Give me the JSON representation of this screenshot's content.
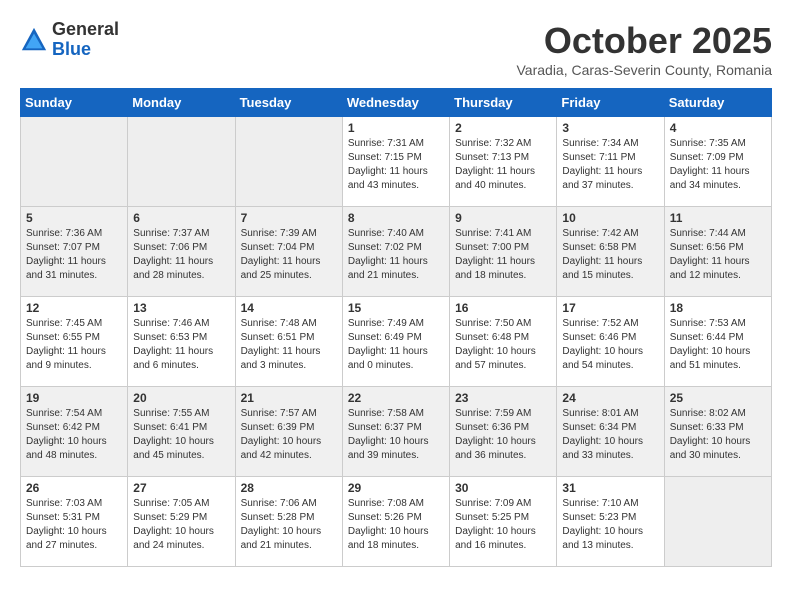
{
  "logo": {
    "general": "General",
    "blue": "Blue"
  },
  "header": {
    "month": "October 2025",
    "subtitle": "Varadia, Caras-Severin County, Romania"
  },
  "weekdays": [
    "Sunday",
    "Monday",
    "Tuesday",
    "Wednesday",
    "Thursday",
    "Friday",
    "Saturday"
  ],
  "weeks": [
    [
      {
        "day": "",
        "empty": true
      },
      {
        "day": "",
        "empty": true
      },
      {
        "day": "",
        "empty": true
      },
      {
        "day": "1",
        "sunrise": "7:31 AM",
        "sunset": "7:15 PM",
        "daylight": "11 hours and 43 minutes."
      },
      {
        "day": "2",
        "sunrise": "7:32 AM",
        "sunset": "7:13 PM",
        "daylight": "11 hours and 40 minutes."
      },
      {
        "day": "3",
        "sunrise": "7:34 AM",
        "sunset": "7:11 PM",
        "daylight": "11 hours and 37 minutes."
      },
      {
        "day": "4",
        "sunrise": "7:35 AM",
        "sunset": "7:09 PM",
        "daylight": "11 hours and 34 minutes."
      }
    ],
    [
      {
        "day": "5",
        "sunrise": "7:36 AM",
        "sunset": "7:07 PM",
        "daylight": "11 hours and 31 minutes."
      },
      {
        "day": "6",
        "sunrise": "7:37 AM",
        "sunset": "7:06 PM",
        "daylight": "11 hours and 28 minutes."
      },
      {
        "day": "7",
        "sunrise": "7:39 AM",
        "sunset": "7:04 PM",
        "daylight": "11 hours and 25 minutes."
      },
      {
        "day": "8",
        "sunrise": "7:40 AM",
        "sunset": "7:02 PM",
        "daylight": "11 hours and 21 minutes."
      },
      {
        "day": "9",
        "sunrise": "7:41 AM",
        "sunset": "7:00 PM",
        "daylight": "11 hours and 18 minutes."
      },
      {
        "day": "10",
        "sunrise": "7:42 AM",
        "sunset": "6:58 PM",
        "daylight": "11 hours and 15 minutes."
      },
      {
        "day": "11",
        "sunrise": "7:44 AM",
        "sunset": "6:56 PM",
        "daylight": "11 hours and 12 minutes."
      }
    ],
    [
      {
        "day": "12",
        "sunrise": "7:45 AM",
        "sunset": "6:55 PM",
        "daylight": "11 hours and 9 minutes."
      },
      {
        "day": "13",
        "sunrise": "7:46 AM",
        "sunset": "6:53 PM",
        "daylight": "11 hours and 6 minutes."
      },
      {
        "day": "14",
        "sunrise": "7:48 AM",
        "sunset": "6:51 PM",
        "daylight": "11 hours and 3 minutes."
      },
      {
        "day": "15",
        "sunrise": "7:49 AM",
        "sunset": "6:49 PM",
        "daylight": "11 hours and 0 minutes."
      },
      {
        "day": "16",
        "sunrise": "7:50 AM",
        "sunset": "6:48 PM",
        "daylight": "10 hours and 57 minutes."
      },
      {
        "day": "17",
        "sunrise": "7:52 AM",
        "sunset": "6:46 PM",
        "daylight": "10 hours and 54 minutes."
      },
      {
        "day": "18",
        "sunrise": "7:53 AM",
        "sunset": "6:44 PM",
        "daylight": "10 hours and 51 minutes."
      }
    ],
    [
      {
        "day": "19",
        "sunrise": "7:54 AM",
        "sunset": "6:42 PM",
        "daylight": "10 hours and 48 minutes."
      },
      {
        "day": "20",
        "sunrise": "7:55 AM",
        "sunset": "6:41 PM",
        "daylight": "10 hours and 45 minutes."
      },
      {
        "day": "21",
        "sunrise": "7:57 AM",
        "sunset": "6:39 PM",
        "daylight": "10 hours and 42 minutes."
      },
      {
        "day": "22",
        "sunrise": "7:58 AM",
        "sunset": "6:37 PM",
        "daylight": "10 hours and 39 minutes."
      },
      {
        "day": "23",
        "sunrise": "7:59 AM",
        "sunset": "6:36 PM",
        "daylight": "10 hours and 36 minutes."
      },
      {
        "day": "24",
        "sunrise": "8:01 AM",
        "sunset": "6:34 PM",
        "daylight": "10 hours and 33 minutes."
      },
      {
        "day": "25",
        "sunrise": "8:02 AM",
        "sunset": "6:33 PM",
        "daylight": "10 hours and 30 minutes."
      }
    ],
    [
      {
        "day": "26",
        "sunrise": "7:03 AM",
        "sunset": "5:31 PM",
        "daylight": "10 hours and 27 minutes."
      },
      {
        "day": "27",
        "sunrise": "7:05 AM",
        "sunset": "5:29 PM",
        "daylight": "10 hours and 24 minutes."
      },
      {
        "day": "28",
        "sunrise": "7:06 AM",
        "sunset": "5:28 PM",
        "daylight": "10 hours and 21 minutes."
      },
      {
        "day": "29",
        "sunrise": "7:08 AM",
        "sunset": "5:26 PM",
        "daylight": "10 hours and 18 minutes."
      },
      {
        "day": "30",
        "sunrise": "7:09 AM",
        "sunset": "5:25 PM",
        "daylight": "10 hours and 16 minutes."
      },
      {
        "day": "31",
        "sunrise": "7:10 AM",
        "sunset": "5:23 PM",
        "daylight": "10 hours and 13 minutes."
      },
      {
        "day": "",
        "empty": true
      }
    ]
  ],
  "row_bg": [
    "#ffffff",
    "#f5f5f5",
    "#ffffff",
    "#f5f5f5",
    "#ffffff"
  ]
}
